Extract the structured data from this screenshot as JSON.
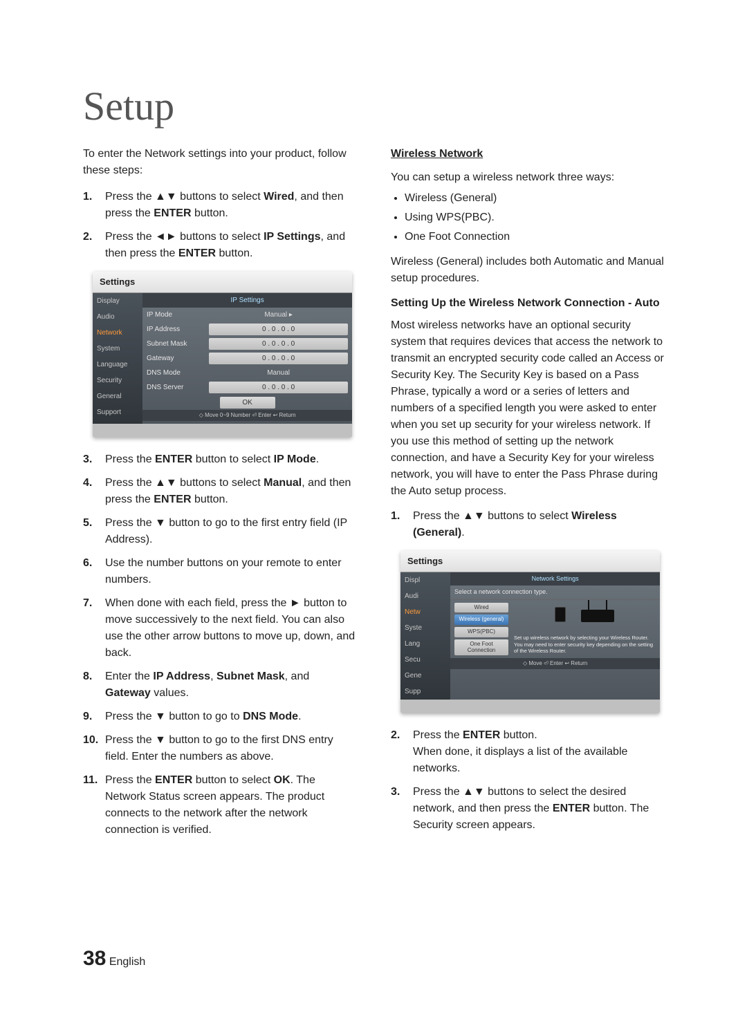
{
  "title": "Setup",
  "left": {
    "intro": "To enter the Network settings into your product, follow these steps:",
    "steps_top": [
      {
        "n": "1.",
        "pre": "Press the ",
        "btn": "▲▼",
        "mid": " buttons to select ",
        "bold": "Wired",
        "post": ", and then press the ",
        "bold2": "ENTER",
        "tail": " button."
      },
      {
        "n": "2.",
        "pre": "Press the ",
        "btn": "◄►",
        "mid": " buttons to select ",
        "bold": "IP Settings",
        "post": ", and then press the ",
        "bold2": "ENTER",
        "tail": " button."
      }
    ],
    "shot": {
      "window": "Settings",
      "panel": "IP Settings",
      "sidebar": [
        "Display",
        "Audio",
        "Network",
        "System",
        "Language",
        "Security",
        "General",
        "Support"
      ],
      "rows": [
        {
          "label": "IP Mode",
          "value": "Manual",
          "plain": true,
          "arrow": "▸"
        },
        {
          "label": "IP Address",
          "value": "0 . 0 . 0 . 0"
        },
        {
          "label": "Subnet Mask",
          "value": "0 . 0 . 0 . 0"
        },
        {
          "label": "Gateway",
          "value": "0 . 0 . 0 . 0"
        },
        {
          "label": "DNS Mode",
          "value": "Manual",
          "plain": true
        },
        {
          "label": "DNS Server",
          "value": "0 . 0 . 0 . 0"
        }
      ],
      "ok": "OK",
      "hints": "◇ Move   0~9 Number   ⏎ Enter   ↩ Return"
    },
    "steps_bottom": [
      {
        "n": "3.",
        "text": "Press the ENTER button to select IP Mode.",
        "bolds": [
          "ENTER",
          "IP Mode"
        ]
      },
      {
        "n": "4.",
        "text": "Press the ▲▼ buttons to select Manual, and then press the ENTER button.",
        "bolds": [
          "Manual",
          "ENTER"
        ]
      },
      {
        "n": "5.",
        "text": "Press the ▼ button to go to the first entry field (IP Address)."
      },
      {
        "n": "6.",
        "text": "Use the number buttons on your remote to enter numbers."
      },
      {
        "n": "7.",
        "text": "When done with each field, press the ► button to move successively to the next field. You can also use the other arrow buttons to move up, down, and back."
      },
      {
        "n": "8.",
        "text": "Enter the IP Address, Subnet Mask, and Gateway values.",
        "bolds": [
          "IP Address",
          "Subnet Mask",
          "Gateway"
        ]
      },
      {
        "n": "9.",
        "text": "Press the ▼ button to go to DNS Mode.",
        "bolds": [
          "DNS Mode"
        ]
      },
      {
        "n": "10.",
        "text": "Press the ▼ button to go to the first DNS entry field. Enter the numbers as above."
      },
      {
        "n": "11.",
        "text": "Press the ENTER button to select OK. The Network Status screen appears. The product connects to the network after the network connection is verified.",
        "bolds": [
          "ENTER",
          "OK"
        ]
      }
    ]
  },
  "right": {
    "h1": "Wireless Network",
    "intro": "You can setup a wireless network three ways:",
    "bullets": [
      "Wireless (General)",
      "Using WPS(PBC).",
      "One Foot Connection"
    ],
    "para": "Wireless (General) includes both Automatic and Manual setup procedures.",
    "h2": "Setting Up the Wireless Network Connection - Auto",
    "body": "Most wireless networks have an optional security system that requires devices that access the network to transmit an encrypted security code called an Access or Security Key. The Security Key is based on a Pass Phrase, typically a word or a series of letters and numbers of a specified length you were asked to enter when you set up security for your wireless network. If you use this method of setting up the network connection, and have a Security Key for your wireless network, you will have to enter the Pass Phrase during the Auto setup process.",
    "steps": [
      {
        "n": "1.",
        "text": "Press the ▲▼ buttons to select Wireless (General).",
        "bolds": [
          "Wireless (General)"
        ]
      }
    ],
    "shot": {
      "window": "Settings",
      "panel": "Network Settings",
      "sub": "Select a network connection type.",
      "sidebar": [
        "Displ",
        "Audi",
        "Netw",
        "Syste",
        "Lang",
        "Secu",
        "Gene",
        "Supp"
      ],
      "opts": [
        "Wired",
        "Wireless (general)",
        "WPS(PBC)",
        "One Foot Connection"
      ],
      "desc": "Set up wireless network by selecting your Wireless Router. You may need to enter security key depending on the setting of the Wireless Router.",
      "hints": "◇ Move   ⏎ Enter   ↩ Return"
    },
    "steps2": [
      {
        "n": "2.",
        "text": "Press the ENTER button.\nWhen done, it displays a list of the available networks.",
        "bolds": [
          "ENTER"
        ]
      },
      {
        "n": "3.",
        "text": "Press the ▲▼ buttons to select the desired network, and then press the ENTER button. The Security screen appears.",
        "bolds": [
          "ENTER"
        ]
      }
    ]
  },
  "footer": {
    "num": "38",
    "lang": "English"
  }
}
